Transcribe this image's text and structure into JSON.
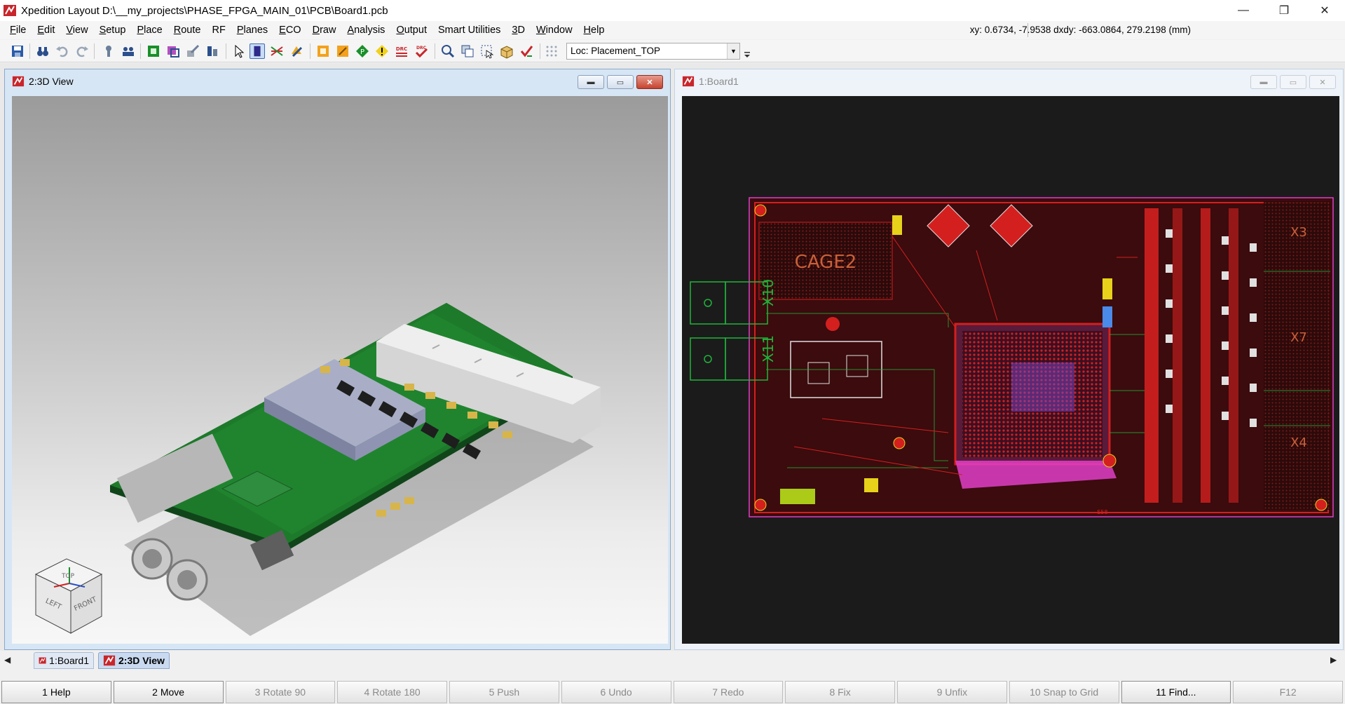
{
  "window": {
    "title": "Xpedition Layout  D:\\__my_projects\\PHASE_FPGA_MAIN_01\\PCB\\Board1.pcb",
    "minimize": "—",
    "restore": "❐",
    "close": "✕"
  },
  "menu": {
    "items": [
      {
        "hot": "F",
        "rest": "ile"
      },
      {
        "hot": "E",
        "rest": "dit"
      },
      {
        "hot": "V",
        "rest": "iew"
      },
      {
        "hot": "S",
        "rest": "etup"
      },
      {
        "hot": "P",
        "rest": "lace"
      },
      {
        "hot": "R",
        "rest": "oute"
      },
      {
        "hot": "",
        "rest": "RF"
      },
      {
        "hot": "P",
        "rest": "lanes"
      },
      {
        "hot": "E",
        "rest": "CO"
      },
      {
        "hot": "D",
        "rest": "raw"
      },
      {
        "hot": "A",
        "rest": "nalysis"
      },
      {
        "hot": "O",
        "rest": "utput"
      },
      {
        "hot": "",
        "rest": "Smart Utilities"
      },
      {
        "hot": "3",
        "rest": "D"
      },
      {
        "hot": "W",
        "rest": "indow"
      },
      {
        "hot": "H",
        "rest": "elp"
      }
    ],
    "coordinates": "xy: 0.6734, -7.9538  dxdy: -663.0864, 279.2198  (mm)"
  },
  "toolbar": {
    "location_label": "Loc: Placement_TOP",
    "dropdown_arrow": "▼"
  },
  "windows": {
    "view3d": {
      "title": "2:3D View",
      "min": "▬",
      "max": "▭",
      "close": "✕",
      "cube": {
        "top": "TOP",
        "left": "LEFT",
        "front": "FRONT"
      }
    },
    "board": {
      "title": "1:Board1",
      "min": "▬",
      "max": "▭",
      "close": "✕",
      "labels": {
        "cage": "CAGE2",
        "x10": "X10",
        "x11": "X11",
        "x3": "X3",
        "x7": "X7",
        "x4": "X4",
        "e58": "E58"
      }
    }
  },
  "tabs": [
    {
      "label": "1:Board1",
      "active": false
    },
    {
      "label": "2:3D View",
      "active": true
    }
  ],
  "scroll": {
    "left": "◀",
    "right": "▶"
  },
  "fkeys": [
    {
      "label": "1 Help",
      "enabled": true
    },
    {
      "label": "2 Move",
      "enabled": true
    },
    {
      "label": "3 Rotate 90",
      "enabled": false
    },
    {
      "label": "4 Rotate 180",
      "enabled": false
    },
    {
      "label": "5 Push",
      "enabled": false
    },
    {
      "label": "6 Undo",
      "enabled": false
    },
    {
      "label": "7 Redo",
      "enabled": false
    },
    {
      "label": "8 Fix",
      "enabled": false
    },
    {
      "label": "9 Unfix",
      "enabled": false
    },
    {
      "label": "10 Snap to Grid",
      "enabled": false
    },
    {
      "label": "11 Find...",
      "enabled": true
    },
    {
      "label": "F12",
      "enabled": false
    }
  ],
  "colors": {
    "app_red": "#c8262b",
    "pcb_red": "#d41f1f",
    "pcb_green": "#1fb43b",
    "pcb_magenta": "#e040c8",
    "board_green": "#1c7a27"
  }
}
